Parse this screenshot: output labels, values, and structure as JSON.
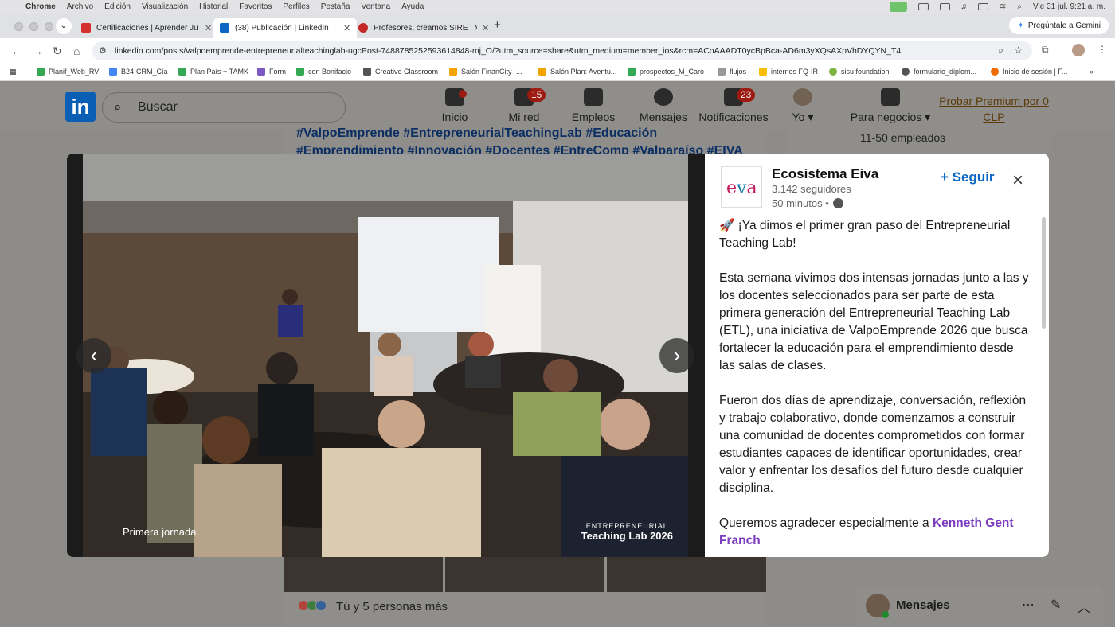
{
  "mac_menu": {
    "app": "Chrome",
    "items": [
      "Archivo",
      "Edición",
      "Visualización",
      "Historial",
      "Favoritos",
      "Perfiles",
      "Pestaña",
      "Ventana",
      "Ayuda"
    ],
    "clock": "Vie 31 jul.  9:21 a. m."
  },
  "tabs": [
    {
      "title": "Certificaciones | Aprender Ju",
      "favicon_color": "#d32f2f",
      "active": false
    },
    {
      "title": "(38) Publicación | LinkedIn",
      "favicon_color": "#0a66c2",
      "active": true
    },
    {
      "title": "Profesores, creamos SIRE | M",
      "favicon_color": "#c62828",
      "active": false
    }
  ],
  "gemini_button": "Pregúntale a Gemini",
  "address_bar": {
    "url": "linkedin.com/posts/valpoemprende-entrepreneurialteachinglab-ugcPost-7488785252593614848-mj_O/?utm_source=share&utm_medium=member_ios&rcm=ACoAAADT0ycBpBca-AD6m3yXQsAXpVhDYQYN_T4"
  },
  "bookmarks": [
    {
      "label": "Planif_Web_RV",
      "color": "#34a853"
    },
    {
      "label": "B24-CRM_Cía",
      "color": "#4285f4"
    },
    {
      "label": "Plan País + TAMK",
      "color": "#34a853"
    },
    {
      "label": "Form",
      "color": "#7e57c2"
    },
    {
      "label": "con Bonifacio",
      "color": "#34a853"
    },
    {
      "label": "Creative Classroom",
      "color": "#555555"
    },
    {
      "label": "Salón FinanCity -...",
      "color": "#f4a300"
    },
    {
      "label": "Salón Plan: Aventu...",
      "color": "#f4a300"
    },
    {
      "label": "prospectos_M_Caro",
      "color": "#34a853"
    },
    {
      "label": "flujos",
      "color": "#777777"
    },
    {
      "label": "internos FQ-IR",
      "color": "#fbbc05"
    },
    {
      "label": "sisu foundation",
      "color": "#7cb342"
    },
    {
      "label": "formulario_diplom...",
      "color": "#555555"
    },
    {
      "label": "Inicio de sesión | F...",
      "color": "#ef6c00"
    }
  ],
  "linkedin": {
    "search_placeholder": "Buscar",
    "nav": [
      {
        "label": "Inicio",
        "badge": "",
        "dot": true
      },
      {
        "label": "Mi red",
        "badge": "15"
      },
      {
        "label": "Empleos",
        "badge": ""
      },
      {
        "label": "Mensajes",
        "badge": ""
      },
      {
        "label": "Notificaciones",
        "badge": "23"
      },
      {
        "label": "Yo ▾",
        "badge": ""
      },
      {
        "label": "Para negocios ▾",
        "badge": ""
      }
    ],
    "premium": "Probar Premium por 0 CLP",
    "hashtags": "#ValpoEmprende #EntrepreneurialTeachingLab #Educación #Emprendimiento #Innovación #Docentes #EntreComp #Valparaíso #EIVA",
    "company_size": "11-50 empleados",
    "reactions_text": "Tú y 5 personas más",
    "messaging_label": "Mensajes"
  },
  "post": {
    "author": "Ecosistema Eiva",
    "followers": "3.142 seguidores",
    "time": "50 minutos •",
    "follow_label": "+ Seguir",
    "close_icon": "×",
    "photo_caption_left": "Primera jornada",
    "photo_caption_right_small": "ENTREPRENEURIAL",
    "photo_caption_right_big": "Teaching Lab 2026",
    "paragraph1": "🚀 ¡Ya dimos el primer gran paso del Entrepreneurial Teaching Lab!",
    "paragraph2": "Esta semana vivimos dos intensas jornadas junto a las y los docentes seleccionados para ser parte de esta primera generación del Entrepreneurial Teaching Lab (ETL), una iniciativa de ValpoEmprende 2026 que busca fortalecer la educación para el emprendimiento desde las salas de clases.",
    "paragraph3": "Fueron dos días de aprendizaje, conversación, reflexión y trabajo colaborativo, donde comenzamos a construir una comunidad de docentes comprometidos con formar estudiantes capaces de identificar oportunidades, crear valor y enfrentar los desafíos del futuro desde cualquier disciplina.",
    "paragraph4_prefix": "Queremos agradecer especialmente a ",
    "paragraph4_link": "Kenneth Gent Franch"
  }
}
